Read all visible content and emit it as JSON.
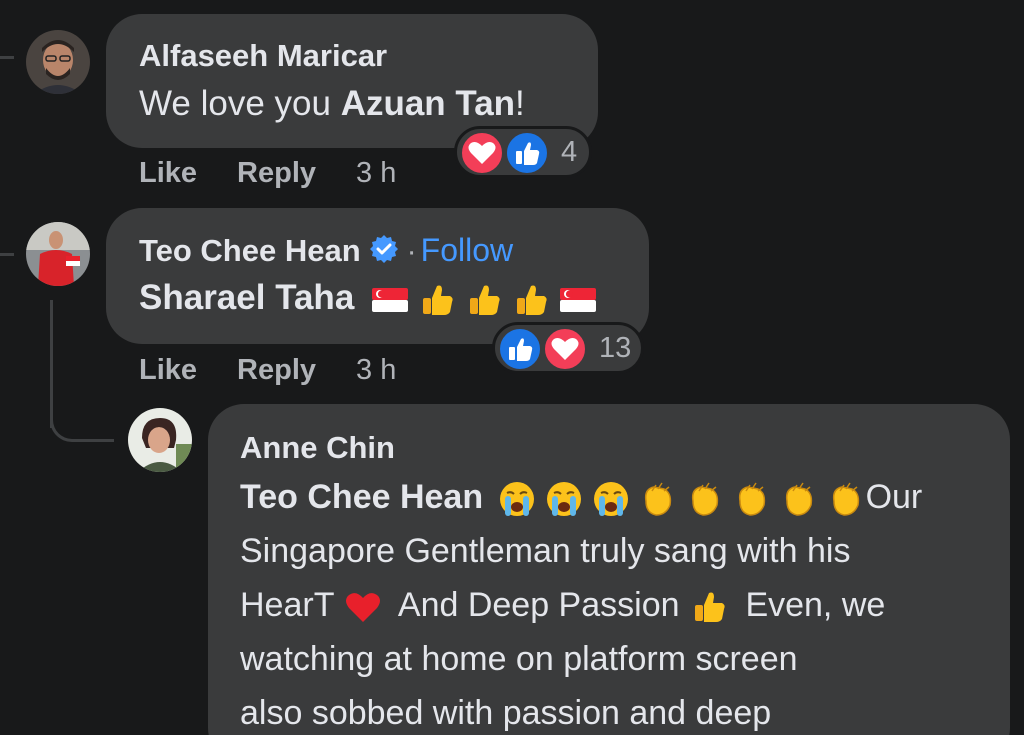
{
  "comments": [
    {
      "author": "Alfaseeh Maricar",
      "text_prefix": "We love you ",
      "text_mention": "Azuan Tan",
      "text_suffix": "!",
      "actions": {
        "like": "Like",
        "reply": "Reply",
        "time": "3 h"
      },
      "reactions": {
        "icons": [
          "love",
          "like"
        ],
        "count": "4"
      }
    },
    {
      "author": "Teo Chee Hean",
      "verified": true,
      "separator": "·",
      "follow": "Follow",
      "text_mention": "Sharael Taha",
      "emojis": [
        "flag-sg",
        "thumbs-up",
        "thumbs-up",
        "thumbs-up",
        "flag-sg"
      ],
      "actions": {
        "like": "Like",
        "reply": "Reply",
        "time": "3 h"
      },
      "reactions": {
        "icons": [
          "like",
          "love"
        ],
        "count": "13"
      }
    }
  ],
  "reply": {
    "author": "Anne Chin",
    "text_mention": "Teo Chee Hean",
    "emojis": [
      "crying-face",
      "crying-face",
      "crying-face",
      "clapping-hands",
      "clapping-hands",
      "clapping-hands",
      "clapping-hands",
      "clapping-hands"
    ],
    "line1_tail": "Our",
    "line2": "Singapore Gentleman truly sang with his",
    "line3_a": "HearT",
    "line3_b": "And Deep Passion",
    "line3_c": "Even, we",
    "line4": "watching at home on platform screen",
    "line5": "also sobbed with passion and deep"
  },
  "colors": {
    "background": "#18191a",
    "bubble": "#3a3b3c",
    "text": "#e4e6eb",
    "secondary": "#b0b3b8",
    "link": "#4599ff",
    "like_blue": "#1b74e4",
    "love_red": "#f33e58"
  }
}
